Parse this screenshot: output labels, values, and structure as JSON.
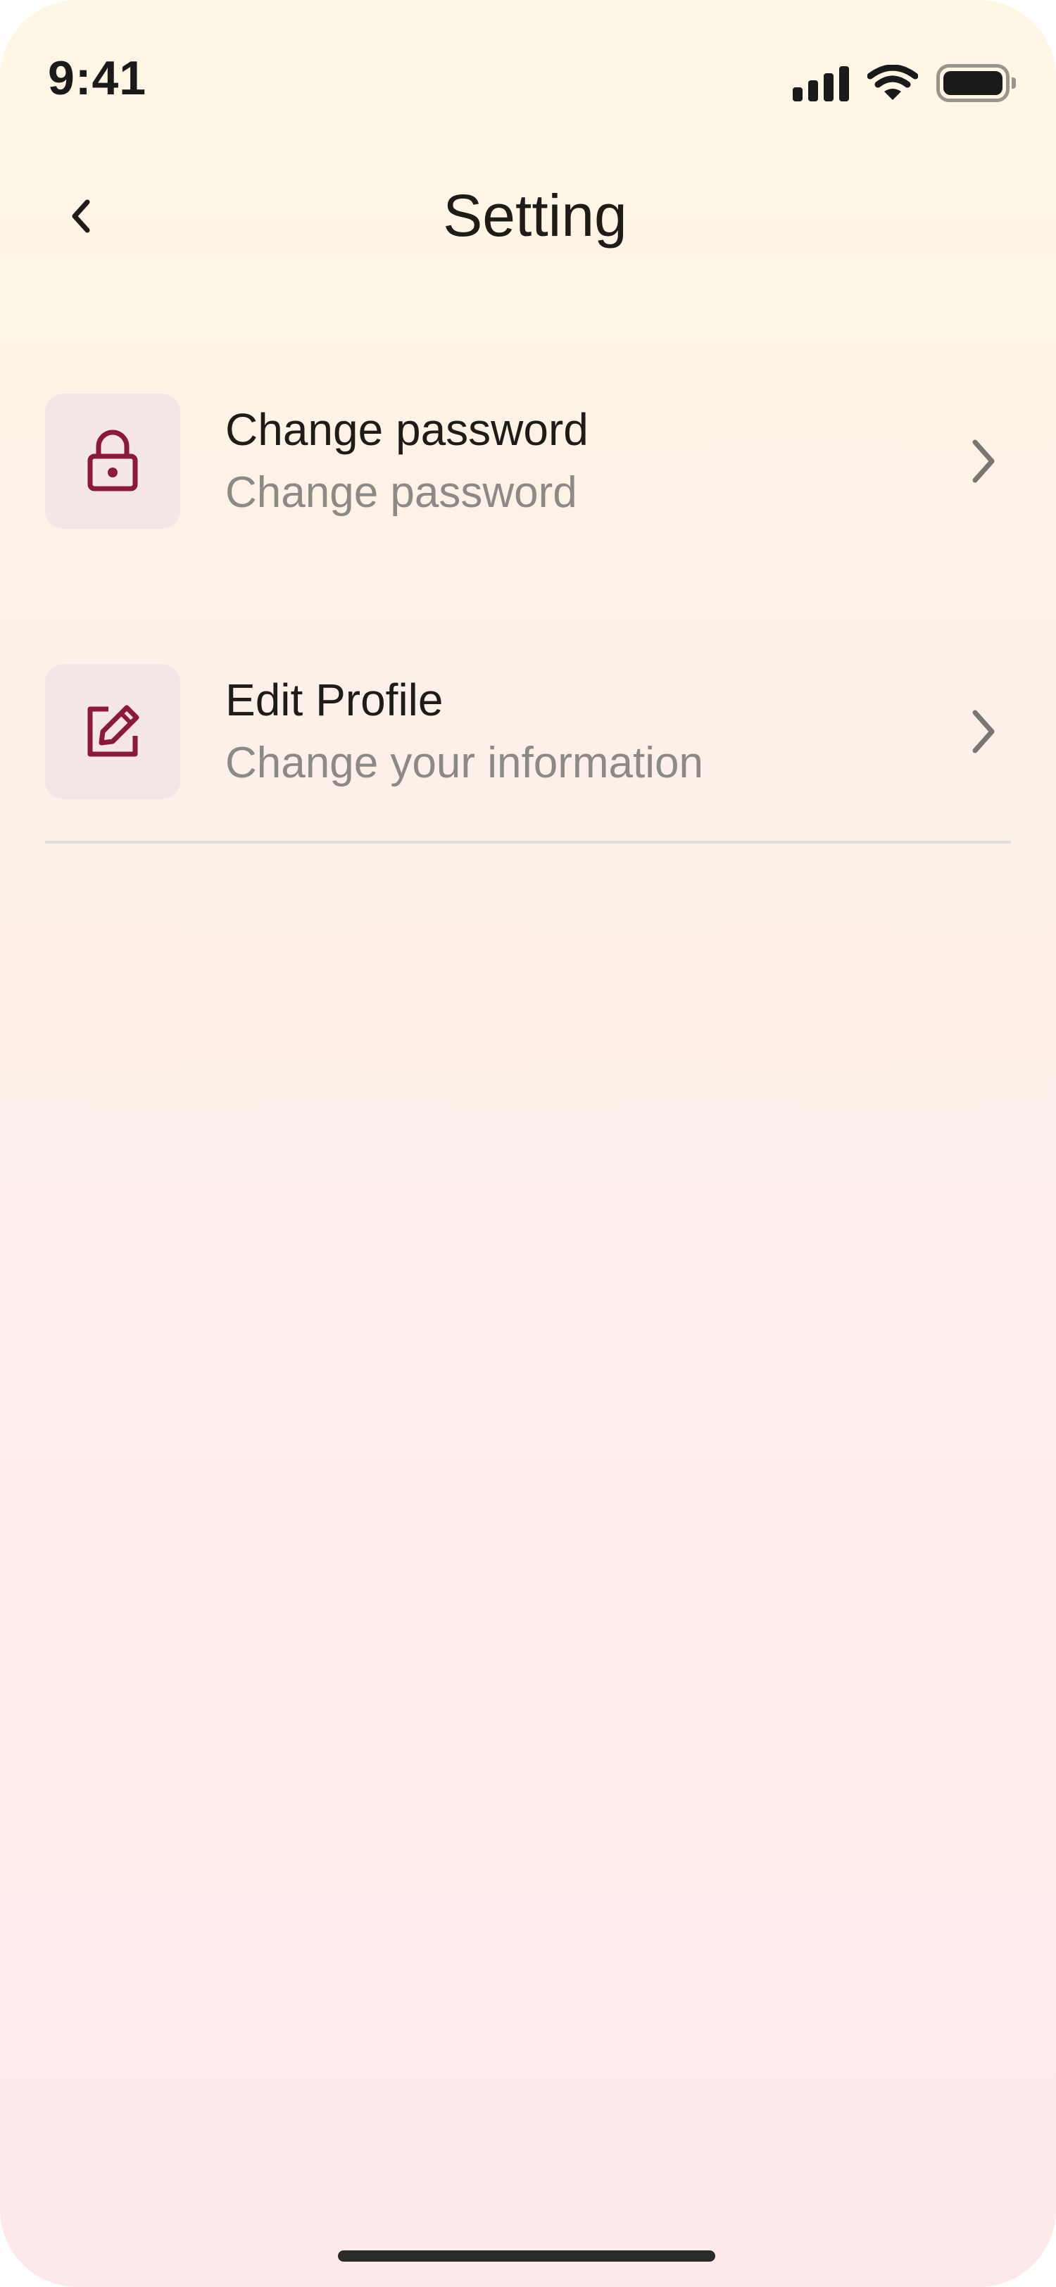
{
  "status_bar": {
    "time": "9:41",
    "icons": [
      "signal-icon",
      "wifi-icon",
      "battery-icon"
    ]
  },
  "header": {
    "title": "Setting",
    "back_icon": "chevron-left-icon"
  },
  "settings": {
    "items": [
      {
        "title": "Change password",
        "subtitle": "Change password",
        "icon": "lock-icon"
      },
      {
        "title": "Edit Profile",
        "subtitle": "Change your information",
        "icon": "edit-icon"
      }
    ]
  },
  "colors": {
    "accent": "#8b1a3a",
    "icon_tile": "#f4e6e6",
    "subtitle": "#8d8a86",
    "chevron": "#7a7672"
  }
}
